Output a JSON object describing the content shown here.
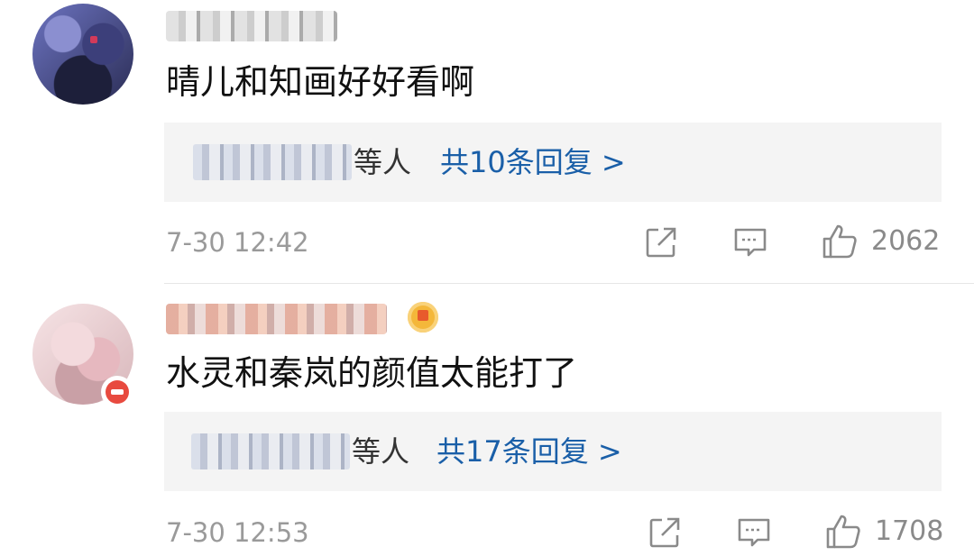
{
  "comments": [
    {
      "comment_text": "晴儿和知画好好看啊",
      "replies_etc": "等人",
      "reply_count_label": "共10条回复 >",
      "time": "7-30 12:42",
      "likes": "2062"
    },
    {
      "comment_text": "水灵和秦岚的颜值太能打了",
      "replies_etc": "等人",
      "reply_count_label": "共17条回复 >",
      "time": "7-30 12:53",
      "likes": "1708"
    }
  ],
  "icons": {
    "share": "share-icon",
    "reply": "comment-icon",
    "like": "thumbs-up-icon"
  },
  "colors": {
    "link": "#1a5fa8",
    "meta": "#9a9a9a",
    "reply_box_bg": "#f4f4f4"
  }
}
